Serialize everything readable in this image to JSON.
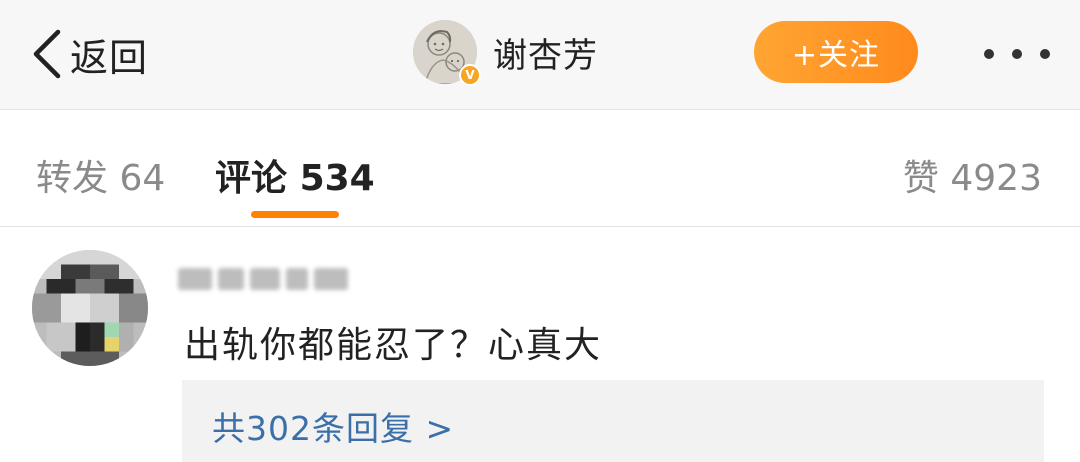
{
  "header": {
    "back_label": "返回",
    "username": "谢杏芳",
    "verified_badge": "V",
    "follow_label": "+关注",
    "accent_color": "#ff8a1c",
    "more_icon": "more-dots-icon"
  },
  "tabs": {
    "repost": {
      "label": "转发",
      "count": "64"
    },
    "comment": {
      "label": "评论",
      "count": "534"
    },
    "like": {
      "label": "赞",
      "count": "4923"
    },
    "active": "comment"
  },
  "comment": {
    "text": "出轨你都能忍了？心真大",
    "reply_link": "共302条回复 >"
  }
}
